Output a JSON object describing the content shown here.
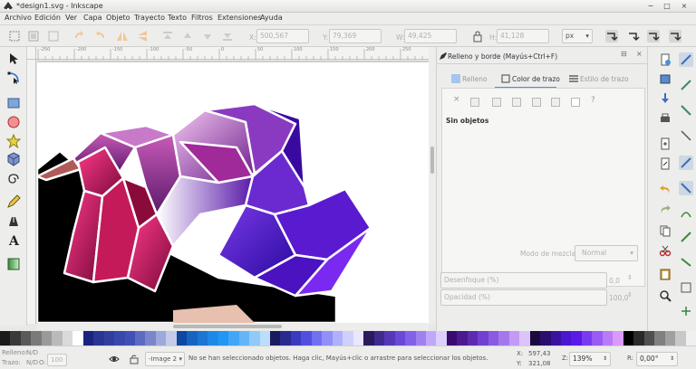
{
  "window": {
    "title": "*design1.svg - Inkscape",
    "controls": [
      "−",
      "□",
      "×"
    ]
  },
  "menu": [
    "Archivo",
    "Edición",
    "Ver",
    "Capa",
    "Objeto",
    "Trayecto",
    "Texto",
    "Filtros",
    "Extensiones",
    "Ayuda"
  ],
  "toolbar": {
    "x_label": "X:",
    "x_value": "500,567",
    "y_label": "Y:",
    "y_value": "79,369",
    "w_label": "W:",
    "w_value": "49,425",
    "h_label": "H:",
    "h_value": "41,128",
    "unit": "px"
  },
  "dock": {
    "title": "Relleno y borde (Mayús+Ctrl+F)",
    "tabs": [
      "Relleno",
      "Color de trazo",
      "Estilo de trazo"
    ],
    "active_tab": 1,
    "no_objects": "Sin objetos",
    "paint_buttons": [
      "×",
      "?"
    ],
    "blend_label": "Modo de mezcla:",
    "blend_value": "Normal",
    "blur_label": "Desenfoque (%)",
    "blur_value": "0,0",
    "opacity_label": "Opacidad (%)",
    "opacity_value": "100,0"
  },
  "statusbar": {
    "fill_label": "Relleno:",
    "fill_value": "N/D",
    "stroke_label": "Trazo:",
    "stroke_value": "N/D",
    "opacity_short": "O:",
    "opacity_value": "100",
    "layer": "-Image 2",
    "message": "No se han seleccionado objetos. Haga clic, Mayús+clic o arrastre para seleccionar los objetos.",
    "x_label": "X:",
    "x_value": "597,43",
    "y_label": "Y:",
    "y_value": "321,08",
    "zoom_label": "Z:",
    "zoom_value": "139%",
    "rotate_label": "R:",
    "rotate_value": "0,00°"
  },
  "ruler_ticks": [
    "-250",
    "-200",
    "-150",
    "-100",
    "-50",
    "0",
    "50",
    "100",
    "150",
    "200",
    "250"
  ],
  "palette_colors": [
    "#1a1a1a",
    "#3a3a3a",
    "#5a5a5a",
    "#7a7a7a",
    "#9a9a9a",
    "#bababa",
    "#dadada",
    "#ffffff",
    "#1a237e",
    "#283593",
    "#303f9f",
    "#3949ab",
    "#3f51b5",
    "#5c6bc0",
    "#7986cb",
    "#9fa8da",
    "#c5cae9",
    "#0d47a1",
    "#1565c0",
    "#1976d2",
    "#1e88e5",
    "#2196f3",
    "#42a5f5",
    "#64b5f6",
    "#90caf9",
    "#bbdefb",
    "#1a1a5e",
    "#2a2a8e",
    "#3a3abe",
    "#5050e0",
    "#7070f0",
    "#9090f8",
    "#b0b0ff",
    "#d0d0ff",
    "#e8e8ff",
    "#2b1a5e",
    "#3f2a8e",
    "#5438b8",
    "#6a48d8",
    "#8460e8",
    "#a080f0",
    "#c0a8f8",
    "#ddd0ff",
    "#3a0a6e",
    "#4b1a8e",
    "#5e2ab0",
    "#7240d0",
    "#8a5ae0",
    "#a478ec",
    "#c29af4",
    "#dcc4fa",
    "#1a0a3e",
    "#2a0e6e",
    "#3a12a0",
    "#4a16d0",
    "#5a1ae8",
    "#7a3af0",
    "#9a5af4",
    "#ba7af8",
    "#da9afc",
    "#000000",
    "#2a2a2a",
    "#505050",
    "#808080",
    "#a0a0a0",
    "#c8c8c8",
    "#f0f0f0"
  ]
}
